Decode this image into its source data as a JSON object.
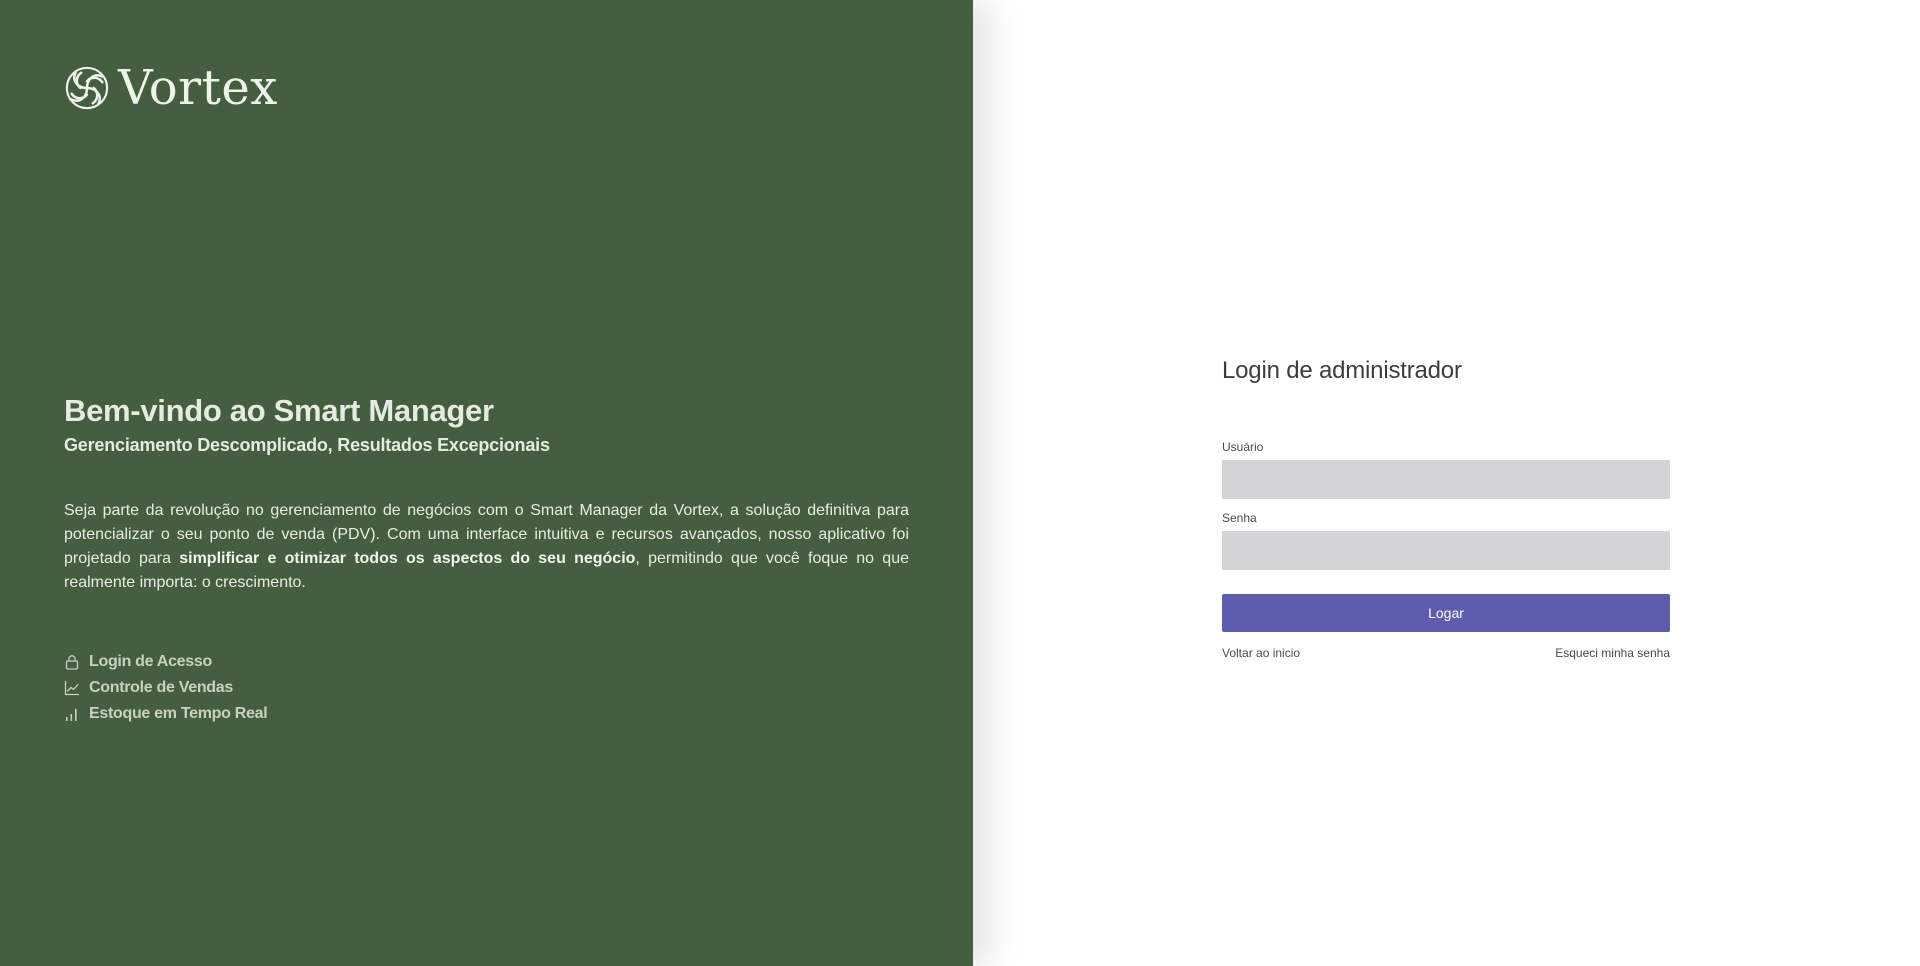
{
  "brand": {
    "name": "Vortex",
    "logo_icon": "vortex-swirl-icon"
  },
  "welcome": {
    "title": "Bem-vindo ao Smart Manager",
    "subtitle": "Gerenciamento Descomplicado, Resultados Excepcionais",
    "description_part1": "Seja parte da revolução no gerenciamento de negócios com o Smart Manager da Vortex, a solução definitiva para potencializar o seu ponto de venda (PDV). Com uma interface intuitiva e recursos avançados, nosso aplicativo foi projetado para ",
    "description_highlight": "simplificar e otimizar todos os aspectos do seu negócio",
    "description_part2": ", permitindo que você foque no que realmente importa: o crescimento."
  },
  "features": [
    {
      "label": "Login de Acesso",
      "icon": "lock-icon"
    },
    {
      "label": "Controle de Vendas",
      "icon": "line-chart-icon"
    },
    {
      "label": "Estoque em Tempo Real",
      "icon": "signal-bars-icon"
    }
  ],
  "login": {
    "title": "Login de administrador",
    "username_label": "Usuário",
    "username_value": "",
    "password_label": "Senha",
    "password_value": "",
    "submit_label": "Logar",
    "back_link": "Voltar ao inicio",
    "forgot_link": "Esqueci minha senha"
  },
  "colors": {
    "left_panel_bg": "#455e3f",
    "button_bg": "#5e5caf",
    "input_bg": "#d4d3d8"
  }
}
